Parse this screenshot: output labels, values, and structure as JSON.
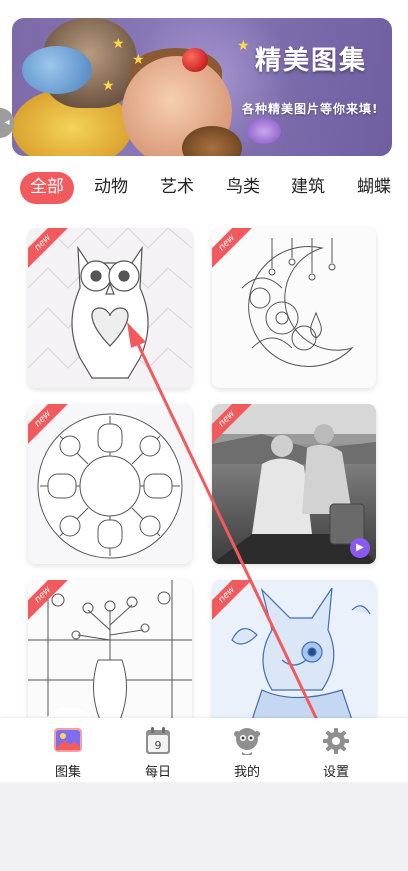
{
  "banner": {
    "title": "精美图集",
    "subtitle": "各种精美图片等你来填!"
  },
  "categories": [
    {
      "label": "全部",
      "active": true
    },
    {
      "label": "动物",
      "active": false
    },
    {
      "label": "艺术",
      "active": false
    },
    {
      "label": "鸟类",
      "active": false
    },
    {
      "label": "建筑",
      "active": false
    },
    {
      "label": "蝴蝶",
      "active": false
    }
  ],
  "gallery": {
    "new_label": "new",
    "items": [
      {
        "subject": "owl-lineart",
        "is_new": true
      },
      {
        "subject": "moon-flowers-lineart",
        "is_new": true
      },
      {
        "subject": "ice-cream-plate-lineart",
        "is_new": true
      },
      {
        "subject": "grayscale-women-photo",
        "is_new": true,
        "video": true
      },
      {
        "subject": "vase-flowers-lineart",
        "is_new": true
      },
      {
        "subject": "cat-blue-painting",
        "is_new": true
      }
    ]
  },
  "bottom_nav": [
    {
      "label": "图集",
      "icon": "gallery-icon",
      "active": true
    },
    {
      "label": "每日",
      "icon": "calendar-icon",
      "calendar_day": "9"
    },
    {
      "label": "我的",
      "icon": "profile-icon"
    },
    {
      "label": "设置",
      "icon": "settings-gear-icon"
    }
  ],
  "colors": {
    "accent": "#f25a5d",
    "banner": "#7c6aa8",
    "video_badge": "#8a59f0",
    "annotation_arrow": "#f25a5d"
  }
}
